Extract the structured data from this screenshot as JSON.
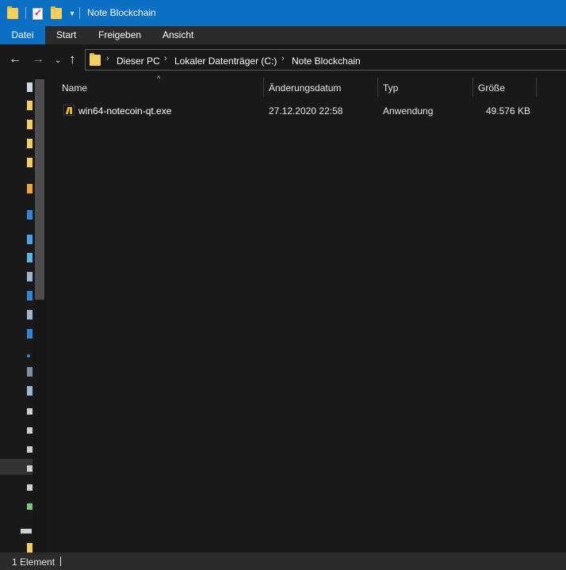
{
  "window": {
    "title": "Note Blockchain",
    "quick_access": {
      "dropdown_glyph": "▾"
    }
  },
  "ribbon": {
    "tabs": [
      {
        "label": "Datei",
        "active": true
      },
      {
        "label": "Start"
      },
      {
        "label": "Freigeben"
      },
      {
        "label": "Ansicht"
      }
    ]
  },
  "navigation": {
    "back_glyph": "←",
    "forward_glyph": "→",
    "recent_glyph": "⌄",
    "up_glyph": "↑",
    "breadcrumb_separator": "›",
    "breadcrumb": [
      "Dieser PC",
      "Lokaler Datenträger (C:)",
      "Note Blockchain"
    ]
  },
  "file_list": {
    "sort_glyph": "^",
    "columns": [
      "Name",
      "Änderungsdatum",
      "Typ",
      "Größe"
    ],
    "rows": [
      {
        "name": "win64-notecoin-qt.exe",
        "modified": "27.12.2020 22:58",
        "type": "Anwendung",
        "size": "49.576 KB"
      }
    ]
  },
  "status": {
    "item_count": "1 Element"
  },
  "colors": {
    "accent": "#0b6fc4",
    "background": "#191919",
    "folder": "#f5cf5b",
    "app_icon": "#e4b52a"
  }
}
